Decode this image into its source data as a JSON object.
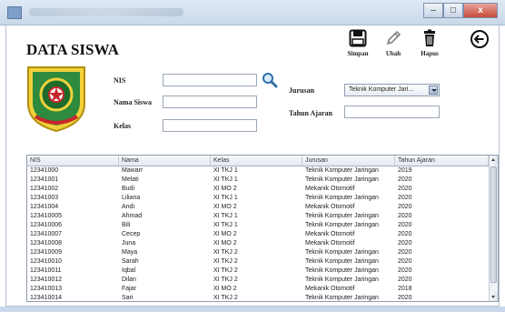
{
  "window": {
    "minimize_glyph": "–",
    "maximize_glyph": "□",
    "close_glyph": "x"
  },
  "page_title": "DATA SISWA",
  "toolbar": {
    "save_label": "Simpan",
    "edit_label": "Ubah",
    "delete_label": "Hapus"
  },
  "form": {
    "nis_label": "NIS",
    "nis_value": "",
    "nama_label": "Nama Siswa",
    "nama_value": "",
    "kelas_label": "Kelas",
    "kelas_value": "",
    "jurusan_label": "Jurusan",
    "jurusan_selected": "Teknik Komputer Jari...",
    "tahun_label": "Tahun Ajaran",
    "tahun_value": ""
  },
  "table": {
    "columns": [
      "NIS",
      "Nama",
      "Kelas",
      "Jurusan",
      "Tahun Ajaran"
    ],
    "rows": [
      [
        "12341000",
        "Mawarr",
        "XI TKJ 1",
        "Teknik Komputer Jaringan",
        "2019"
      ],
      [
        "12341001",
        "Melati",
        "XI TKJ 1",
        "Teknik Komputer Jaringan",
        "2020"
      ],
      [
        "12341002",
        "Budi",
        "XI MO 2",
        "Mekanik Otomotif",
        "2020"
      ],
      [
        "12341003",
        "Liliana",
        "XI TKJ 1",
        "Teknik Komputer Jaringan",
        "2020"
      ],
      [
        "12341004",
        "Andi",
        "XI MO 2",
        "Mekanik Otomotif",
        "2020"
      ],
      [
        "123410005",
        "Ahmad",
        "XI TKJ 1",
        "Teknik Komputer Jaringan",
        "2020"
      ],
      [
        "123410006",
        "Bili",
        "XI TKJ 1",
        "Teknik Komputer Jaringan",
        "2020"
      ],
      [
        "123410007",
        "Cecep",
        "XI MO 2",
        "Mekanik Otomotif",
        "2020"
      ],
      [
        "123410008",
        "Juna",
        "XI MO 2",
        "Mekanik Otomotif",
        "2020"
      ],
      [
        "123410009",
        "Maya",
        "XI TKJ 2",
        "Teknik Komputer Jaringan",
        "2020"
      ],
      [
        "123410010",
        "Sarah",
        "XI TKJ 2",
        "Teknik Komputer Jaringan",
        "2020"
      ],
      [
        "123410011",
        "Iqbal",
        "XI TKJ 2",
        "Teknik Komputer Jaringan",
        "2020"
      ],
      [
        "123410012",
        "Dilan",
        "XI TKJ 2",
        "Teknik Komputer Jaringan",
        "2020"
      ],
      [
        "123410013",
        "Fajar",
        "XI MO 2",
        "Mekanik Otomotif",
        "2018"
      ],
      [
        "123410014",
        "Sari",
        "XI TKJ 2",
        "Teknik Komputer Jaringan",
        "2020"
      ]
    ]
  }
}
